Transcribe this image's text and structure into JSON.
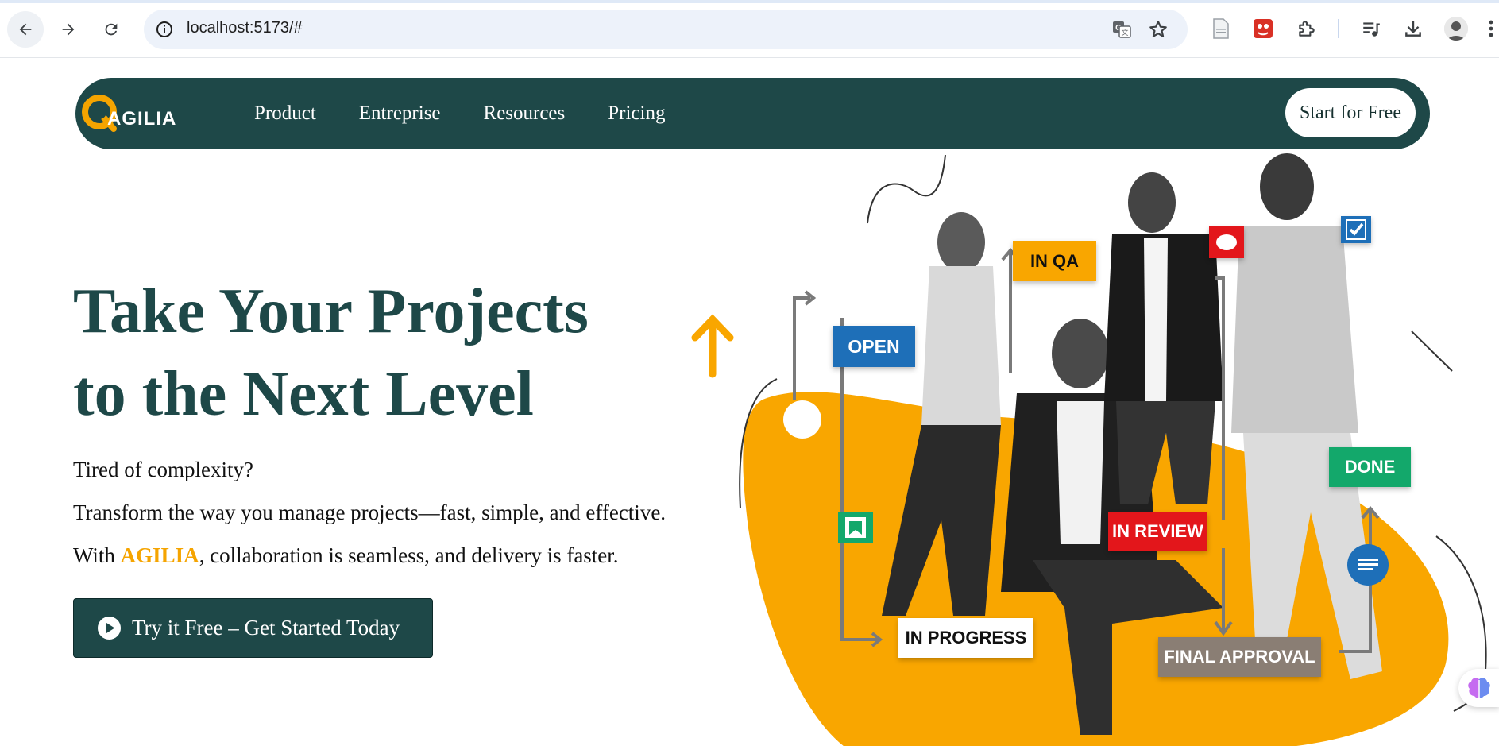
{
  "browser": {
    "url": "localhost:5173/#",
    "icons": [
      "back-icon",
      "forward-icon",
      "reload-icon",
      "info-icon",
      "translate-icon",
      "star-icon",
      "document-icon",
      "extension-red-icon",
      "puzzle-icon",
      "media-queue-icon",
      "download-icon",
      "profile-avatar",
      "menu-icon"
    ]
  },
  "header": {
    "logo_text": "AGILIA",
    "menu": [
      "Product",
      "Entreprise",
      "Resources",
      "Pricing"
    ],
    "cta": "Start for Free"
  },
  "hero": {
    "title_line1": "Take Your Projects",
    "title_line2": "to the Next Level",
    "p1": "Tired of complexity?",
    "p2": "Transform the way you manage projects—fast, simple, and effective.",
    "p3_before": "With ",
    "p3_brand": "AGILIA",
    "p3_after": ", collaboration is seamless, and delivery is faster.",
    "cta": "Try it Free – Get Started Today"
  },
  "workflow": {
    "open": "OPEN",
    "in_qa": "IN QA",
    "in_progress": "IN PROGRESS",
    "in_review": "IN REVIEW",
    "final_approval": "FINAL APPROVAL",
    "done": "DONE"
  },
  "colors": {
    "brand_dark": "#1e4848",
    "brand_orange": "#f5a400",
    "open_blue": "#1e6fb8",
    "review_red": "#e3161b",
    "done_green": "#13a86b",
    "approval_gray": "#8a7e74"
  }
}
